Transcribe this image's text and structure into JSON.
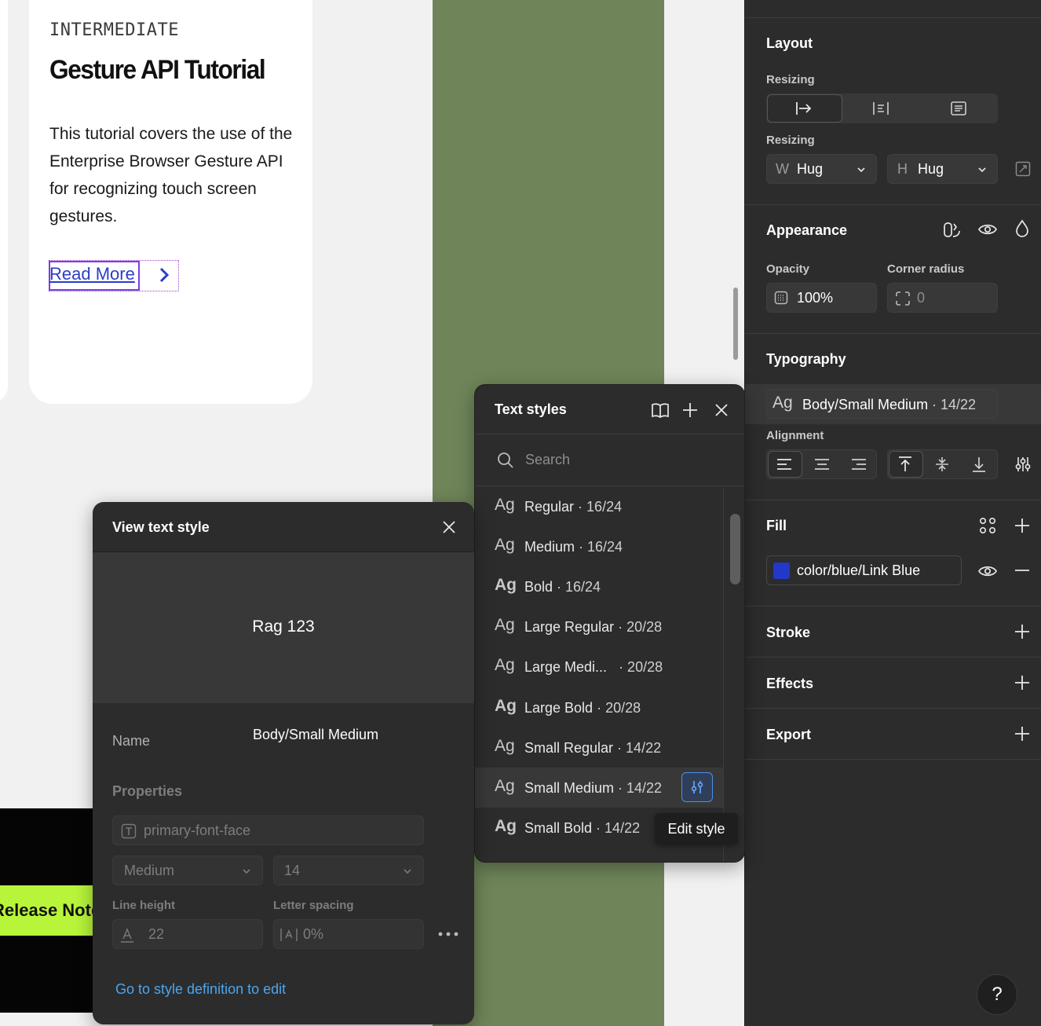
{
  "card": {
    "eyebrow": "INTERMEDIATE",
    "title": "Gesture API Tutorial",
    "description": "This tutorial covers the use of the Enterprise Browser Gesture API for recognizing touch screen gestures.",
    "link": "Read More"
  },
  "canvas": {
    "release_button": "Release Notes"
  },
  "panel": {
    "layout": {
      "title": "Layout",
      "resizing_label": "Resizing",
      "resizing_label2": "Resizing",
      "width_prefix": "W",
      "width_value": "Hug",
      "height_prefix": "H",
      "height_value": "Hug"
    },
    "appearance": {
      "title": "Appearance",
      "opacity_label": "Opacity",
      "opacity_value": "100%",
      "corner_label": "Corner radius",
      "corner_value": "0"
    },
    "typography": {
      "title": "Typography",
      "style_ag": "Ag",
      "style_name": "Body/Small Medium",
      "style_size": " · 14/22",
      "alignment_label": "Alignment"
    },
    "fill": {
      "title": "Fill",
      "color_name": "color/blue/Link Blue",
      "swatch": "#2438c8"
    },
    "stroke": {
      "title": "Stroke"
    },
    "effects": {
      "title": "Effects"
    },
    "export": {
      "title": "Export"
    }
  },
  "text_styles": {
    "title": "Text styles",
    "search_placeholder": "Search",
    "items": [
      {
        "ag": "Ag",
        "name": "Regular",
        "size": " · 16/24"
      },
      {
        "ag": "Ag",
        "name": "Medium",
        "size": " · 16/24"
      },
      {
        "ag": "Ag",
        "name": "Bold",
        "size": " · 16/24"
      },
      {
        "ag": "Ag",
        "name": "Large Regular",
        "size": " · 20/28"
      },
      {
        "ag": "Ag",
        "name": "Large Medi...",
        "size": " · 20/28"
      },
      {
        "ag": "Ag",
        "name": "Large Bold",
        "size": " · 20/28"
      },
      {
        "ag": "Ag",
        "name": "Small Regular",
        "size": " · 14/22"
      },
      {
        "ag": "Ag",
        "name": "Small Medium",
        "size": " · 14/22"
      },
      {
        "ag": "Ag",
        "name": "Small Bold",
        "size": " · 14/22"
      }
    ],
    "tooltip": "Edit style"
  },
  "view_text_style": {
    "title": "View text style",
    "preview": "Rag 123",
    "name_label": "Name",
    "name_value": "Body/Small Medium",
    "properties_label": "Properties",
    "font_face": "primary-font-face",
    "weight": "Medium",
    "size": "14",
    "line_height_label": "Line height",
    "line_height_value": "22",
    "letter_spacing_label": "Letter spacing",
    "letter_spacing_value": "0%",
    "link": "Go to style definition to edit"
  },
  "help": "?"
}
